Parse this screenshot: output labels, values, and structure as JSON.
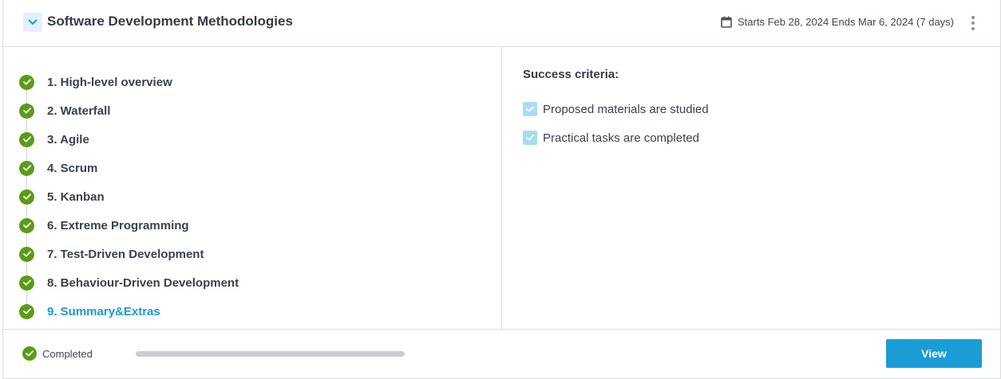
{
  "header": {
    "title": "Software Development Methodologies",
    "dates": "Starts Feb 28, 2024 Ends Mar 6, 2024 (7 days)"
  },
  "steps": [
    {
      "label": "1. High-level overview",
      "status": "completed"
    },
    {
      "label": "2. Waterfall",
      "status": "completed"
    },
    {
      "label": "3. Agile",
      "status": "completed"
    },
    {
      "label": "4. Scrum",
      "status": "completed"
    },
    {
      "label": "5. Kanban",
      "status": "completed"
    },
    {
      "label": "6. Extreme Programming",
      "status": "completed"
    },
    {
      "label": "7. Test-Driven Development",
      "status": "completed"
    },
    {
      "label": "8. Behaviour-Driven Development",
      "status": "completed"
    },
    {
      "label": "9. Summary&Extras",
      "status": "completed",
      "active": true
    }
  ],
  "criteria": {
    "title": "Success criteria:",
    "items": [
      {
        "label": "Proposed materials are studied",
        "checked": true
      },
      {
        "label": "Practical tasks are completed",
        "checked": true
      }
    ]
  },
  "footer": {
    "status": "Completed",
    "progress_percent": 100,
    "view_label": "View"
  },
  "colors": {
    "accent": "#1a9cd6",
    "success": "#5b9b18",
    "active_step": "#1c9ad0",
    "checkbox": "#a9dcf1"
  },
  "icons": {
    "collapse": "chevron-down-icon",
    "calendar": "calendar-icon",
    "more": "more-vertical-icon",
    "step": "check-circle-icon",
    "criterion": "checkbox-checked-icon"
  }
}
